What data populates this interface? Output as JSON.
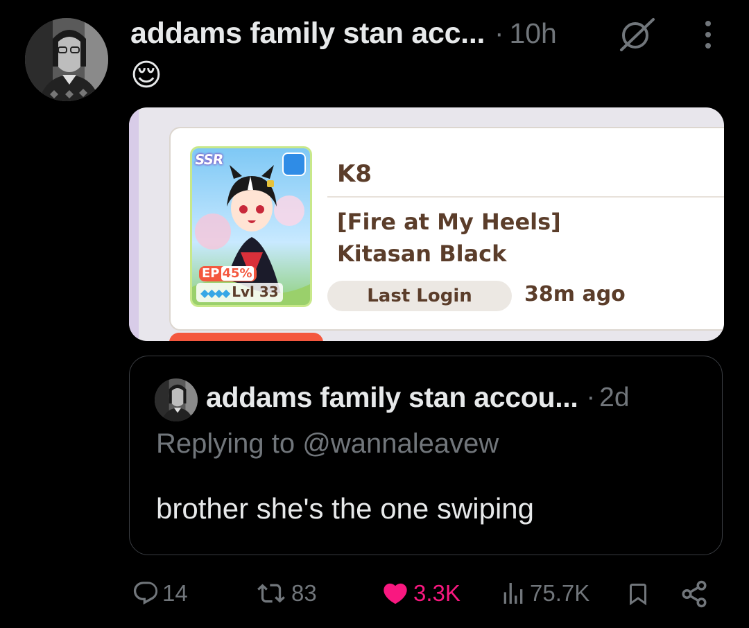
{
  "post": {
    "author_name": "addams family stan acc...",
    "separator": "·",
    "time": "10h",
    "text": "😌"
  },
  "media": {
    "trainer_name": "K8",
    "character_title_line1": "[Fire at My Heels]",
    "character_title_line2": "Kitasan Black",
    "last_login_label": "Last Login",
    "last_login_value": "38m ago",
    "card": {
      "rarity": "SSR",
      "ep_label": "EP",
      "ep_value": "45%",
      "level": "Lvl 33",
      "gems": "◆◆◆◆"
    }
  },
  "quote": {
    "author_name": "addams family stan accou...",
    "separator": "·",
    "time": "2d",
    "replying_to": "Replying to @wannaleavew",
    "text": "brother she's the one swiping"
  },
  "actions": {
    "replies": "14",
    "reposts": "83",
    "likes": "3.3K",
    "views": "75.7K"
  },
  "colors": {
    "background": "#000000",
    "text_primary": "#e7e9ea",
    "text_secondary": "#71767b",
    "like_active": "#f91880",
    "quote_border": "#3a3d42",
    "game_text_brown": "#5b3d2a",
    "game_accent_orange": "#f4573e"
  },
  "icons": [
    "grok-icon",
    "more-vertical-icon",
    "reply-icon",
    "repost-icon",
    "heart-icon",
    "views-icon",
    "bookmark-icon",
    "share-icon"
  ]
}
